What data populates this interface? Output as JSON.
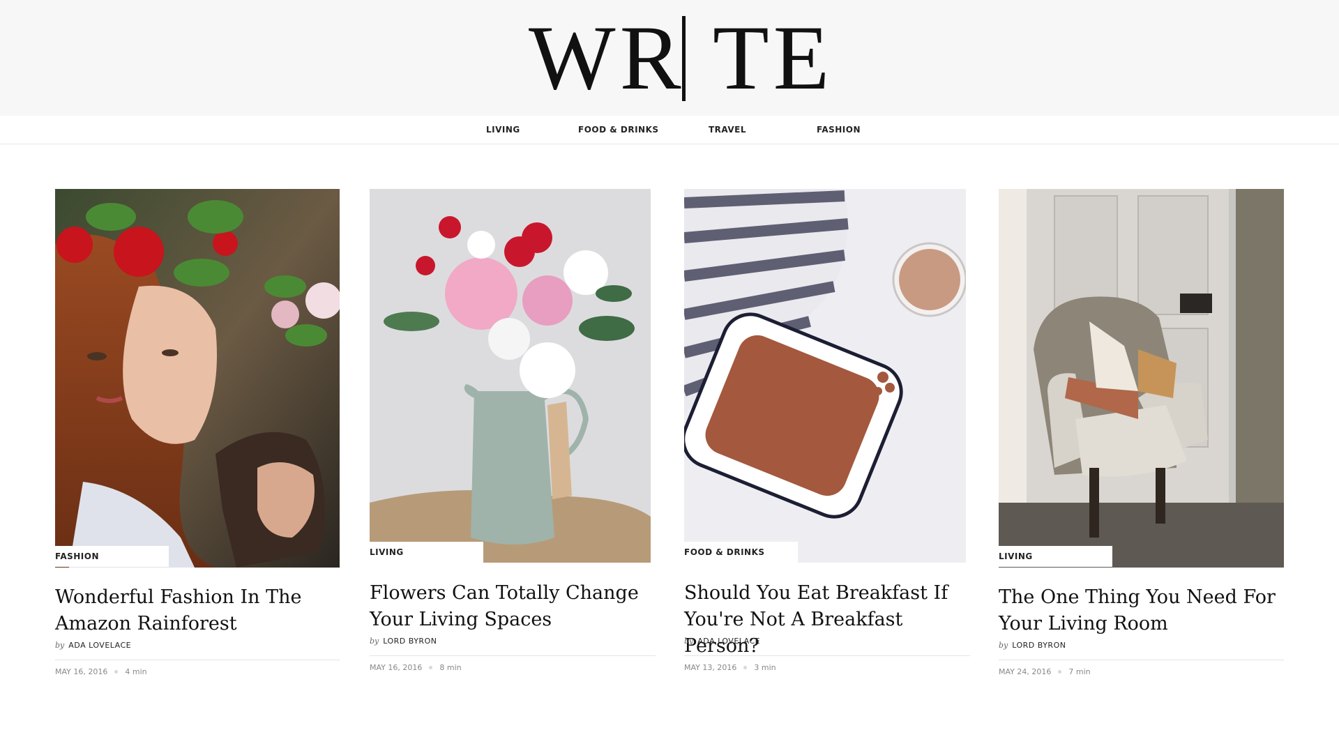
{
  "site": {
    "logo_left": "WR",
    "logo_right": "TE"
  },
  "nav": {
    "items": [
      "LIVING",
      "FOOD & DRINKS",
      "TRAVEL",
      "FASHION"
    ]
  },
  "posts": [
    {
      "category": "FASHION",
      "title_line1": "Wonderful Fashion In The",
      "title_line2": "Amazon Rainforest",
      "by": "by",
      "author": "ADA LOVELACE",
      "date": "MAY 16, 2016",
      "read_time": "4 min"
    },
    {
      "category": "LIVING",
      "title_line1": "Flowers Can Totally Change",
      "title_line2": "Your Living Spaces",
      "by": "by",
      "author": "LORD BYRON",
      "date": "MAY 16, 2016",
      "read_time": "8 min"
    },
    {
      "category": "FOOD & DRINKS",
      "title_line1": "Should You Eat Breakfast If",
      "title_line2": "You're Not A Breakfast Person?",
      "by": "by",
      "author": "ADA LOVELACE",
      "date": "MAY 13, 2016",
      "read_time": "3 min"
    },
    {
      "category": "LIVING",
      "title_line1": "The One Thing You Need For",
      "title_line2": "Your Living Room",
      "by": "by",
      "author": "LORD BYRON",
      "date": "MAY 24, 2016",
      "read_time": "7 min"
    }
  ],
  "colors": {
    "header_bg": "#f7f7f7",
    "text": "#111111",
    "meta": "#888888"
  }
}
